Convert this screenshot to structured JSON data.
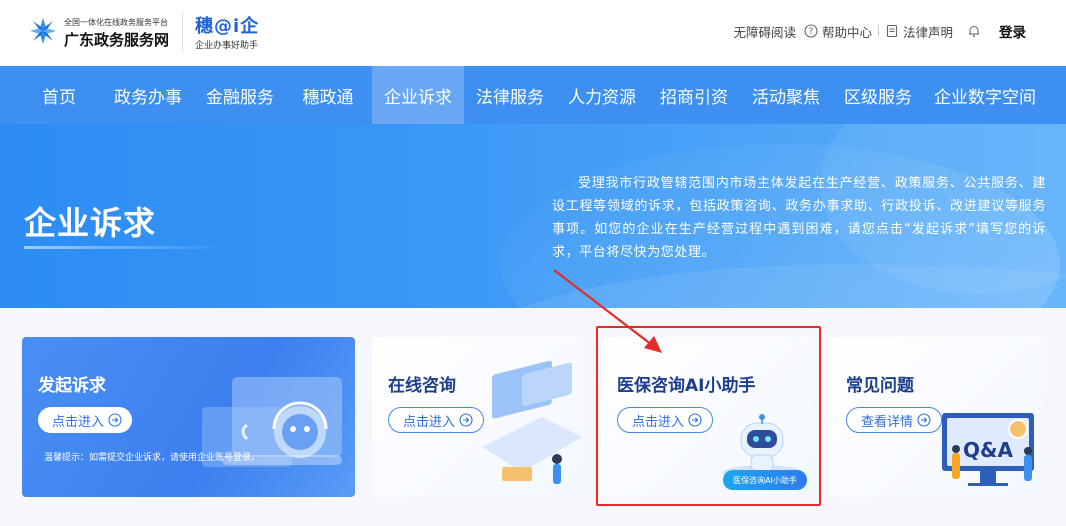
{
  "header": {
    "logo_small": "全国一体化在线政务服务平台",
    "logo_big": "广东政务服务网",
    "brand2_title": "穗@i企",
    "brand2_sub": "企业办事好助手",
    "links": {
      "accessibility": "无障碍阅读",
      "help": "帮助中心",
      "legal": "法律声明",
      "login": "登录"
    }
  },
  "nav": {
    "items": [
      {
        "label": "首页"
      },
      {
        "label": "政务办事"
      },
      {
        "label": "金融服务"
      },
      {
        "label": "穗政通"
      },
      {
        "label": "企业诉求"
      },
      {
        "label": "法律服务"
      },
      {
        "label": "人力资源"
      },
      {
        "label": "招商引资"
      },
      {
        "label": "活动聚焦"
      },
      {
        "label": "区级服务"
      },
      {
        "label": "企业数字空间"
      }
    ],
    "active_label": "企业诉求"
  },
  "banner": {
    "title": "企业诉求",
    "description": "受理我市行政管辖范围内市场主体发起在生产经营、政策服务、公共服务、建设工程等领域的诉求，包括政策咨询、政务办事求助、行政投诉、改进建议等服务事项。如您的企业在生产经营过程中遇到困难，请您点击“发起诉求”填写您的诉求，平台将尽快为您处理。"
  },
  "cards": [
    {
      "title": "发起诉求",
      "button": "点击进入",
      "tip": "温馨提示：如需提交企业诉求，请使用企业账号登录。"
    },
    {
      "title": "在线咨询",
      "button": "点击进入"
    },
    {
      "title": "医保咨询AI小助手",
      "button": "点击进入",
      "badge": "医保咨询AI小助手"
    },
    {
      "title": "常见问题",
      "button": "查看详情"
    }
  ],
  "colors": {
    "nav_bg": "#3d8ff0",
    "banner_start": "#2b8cf3",
    "card_title": "#1d3f8c",
    "highlight": "#e32b2b"
  }
}
